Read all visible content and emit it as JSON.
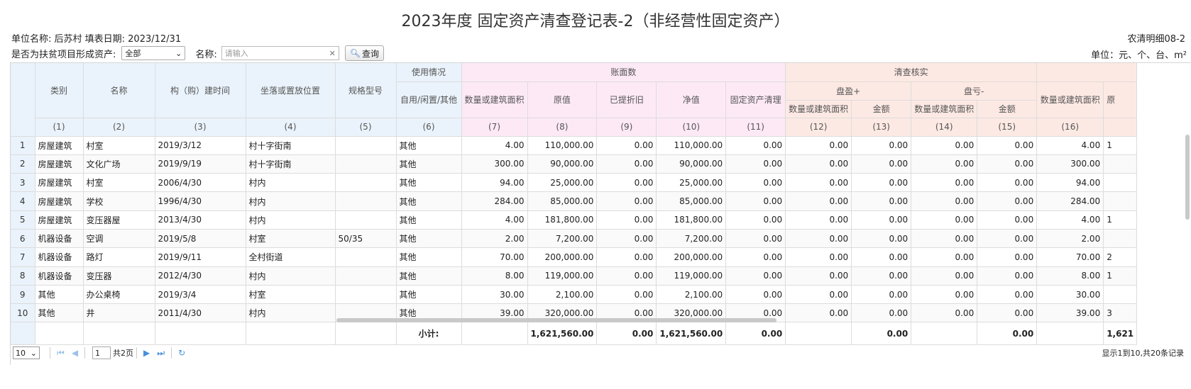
{
  "title": "2023年度 固定资产清查登记表-2（非经营性固定资产）",
  "meta": {
    "left": "单位名称:   后苏村  填表日期:   2023/12/31",
    "right": "农清明细08-2",
    "unit": "单位：元、个、台、m²"
  },
  "filters": {
    "poverty_label": "是否为扶贫项目形成资产:",
    "poverty_value": "全部",
    "name_label": "名称:",
    "name_placeholder": "请输入",
    "query_button": "查询"
  },
  "headers": {
    "category": "类别",
    "name": "名称",
    "build_time": "构（购）建时间",
    "location": "坐落或置放位置",
    "spec": "规格型号",
    "usage_group": "使用情况",
    "usage": "自用/闲置/其他",
    "book_group": "账面数",
    "book_qty": "数量或建筑面积",
    "original": "原值",
    "depreciation": "已提折旧",
    "net": "净值",
    "cleanup": "固定资产清理",
    "check_group": "清查核实",
    "surplus_group": "盘盈+",
    "surplus_qty": "数量或建筑面积",
    "surplus_amt": "金额",
    "loss_group": "盘亏-",
    "loss_qty": "数量或建筑面积",
    "loss_amt": "金额",
    "check_qty": "数量或建筑面积",
    "check_next": "原"
  },
  "col_numbers": [
    "(1)",
    "(2)",
    "(3)",
    "(4)",
    "(5)",
    "(6)",
    "(7)",
    "(8)",
    "(9)",
    "(10)",
    "(11)",
    "(12)",
    "(13)",
    "(14)",
    "(15)",
    "(16)"
  ],
  "rows": [
    {
      "no": "1",
      "cat": "房屋建筑",
      "name": "村室",
      "time": "2019/3/12",
      "loc": "村十字街南",
      "spec": "",
      "use": "其他",
      "qty": "4.00",
      "orig": "110,000.00",
      "dep": "0.00",
      "net": "110,000.00",
      "clean": "0.00",
      "sq": "0.00",
      "sa": "0.00",
      "lq": "0.00",
      "la": "0.00",
      "cq": "4.00",
      "next": "1"
    },
    {
      "no": "2",
      "cat": "房屋建筑",
      "name": "文化广场",
      "time": "2019/9/19",
      "loc": "村十字街南",
      "spec": "",
      "use": "其他",
      "qty": "300.00",
      "orig": "90,000.00",
      "dep": "0.00",
      "net": "90,000.00",
      "clean": "0.00",
      "sq": "0.00",
      "sa": "0.00",
      "lq": "0.00",
      "la": "0.00",
      "cq": "300.00",
      "next": ""
    },
    {
      "no": "3",
      "cat": "房屋建筑",
      "name": "村室",
      "time": "2006/4/30",
      "loc": "村内",
      "spec": "",
      "use": "其他",
      "qty": "94.00",
      "orig": "25,000.00",
      "dep": "0.00",
      "net": "25,000.00",
      "clean": "0.00",
      "sq": "0.00",
      "sa": "0.00",
      "lq": "0.00",
      "la": "0.00",
      "cq": "94.00",
      "next": ""
    },
    {
      "no": "4",
      "cat": "房屋建筑",
      "name": "学校",
      "time": "1996/4/30",
      "loc": "村内",
      "spec": "",
      "use": "其他",
      "qty": "284.00",
      "orig": "85,000.00",
      "dep": "0.00",
      "net": "85,000.00",
      "clean": "0.00",
      "sq": "0.00",
      "sa": "0.00",
      "lq": "0.00",
      "la": "0.00",
      "cq": "284.00",
      "next": ""
    },
    {
      "no": "5",
      "cat": "房屋建筑",
      "name": "变压器屋",
      "time": "2013/4/30",
      "loc": "村内",
      "spec": "",
      "use": "其他",
      "qty": "4.00",
      "orig": "181,800.00",
      "dep": "0.00",
      "net": "181,800.00",
      "clean": "0.00",
      "sq": "0.00",
      "sa": "0.00",
      "lq": "0.00",
      "la": "0.00",
      "cq": "4.00",
      "next": "1"
    },
    {
      "no": "6",
      "cat": "机器设备",
      "name": "空调",
      "time": "2019/5/8",
      "loc": "村室",
      "spec": "50/35",
      "use": "其他",
      "qty": "2.00",
      "orig": "7,200.00",
      "dep": "0.00",
      "net": "7,200.00",
      "clean": "0.00",
      "sq": "0.00",
      "sa": "0.00",
      "lq": "0.00",
      "la": "0.00",
      "cq": "2.00",
      "next": ""
    },
    {
      "no": "7",
      "cat": "机器设备",
      "name": "路灯",
      "time": "2019/9/11",
      "loc": "全村街道",
      "spec": "",
      "use": "其他",
      "qty": "70.00",
      "orig": "200,000.00",
      "dep": "0.00",
      "net": "200,000.00",
      "clean": "0.00",
      "sq": "0.00",
      "sa": "0.00",
      "lq": "0.00",
      "la": "0.00",
      "cq": "70.00",
      "next": "2"
    },
    {
      "no": "8",
      "cat": "机器设备",
      "name": "变压器",
      "time": "2012/4/30",
      "loc": "村内",
      "spec": "",
      "use": "其他",
      "qty": "8.00",
      "orig": "119,000.00",
      "dep": "0.00",
      "net": "119,000.00",
      "clean": "0.00",
      "sq": "0.00",
      "sa": "0.00",
      "lq": "0.00",
      "la": "0.00",
      "cq": "8.00",
      "next": "1"
    },
    {
      "no": "9",
      "cat": "其他",
      "name": "办公桌椅",
      "time": "2019/3/4",
      "loc": "村室",
      "spec": "",
      "use": "其他",
      "qty": "30.00",
      "orig": "2,100.00",
      "dep": "0.00",
      "net": "2,100.00",
      "clean": "0.00",
      "sq": "0.00",
      "sa": "0.00",
      "lq": "0.00",
      "la": "0.00",
      "cq": "30.00",
      "next": ""
    },
    {
      "no": "10",
      "cat": "其他",
      "name": "井",
      "time": "2011/4/30",
      "loc": "村内",
      "spec": "",
      "use": "其他",
      "qty": "39.00",
      "orig": "320,000.00",
      "dep": "0.00",
      "net": "320,000.00",
      "clean": "0.00",
      "sq": "0.00",
      "sa": "0.00",
      "lq": "0.00",
      "la": "0.00",
      "cq": "39.00",
      "next": "3"
    }
  ],
  "summary": {
    "label": "小计:",
    "orig": "1,621,560.00",
    "dep": "0.00",
    "net": "1,621,560.00",
    "clean": "0.00",
    "sa": "0.00",
    "la": "0.00",
    "next": "1,621"
  },
  "pager": {
    "page_size": "10",
    "current_page": "1",
    "total_pages": "共2页",
    "info": "显示1到10,共20条记录"
  }
}
